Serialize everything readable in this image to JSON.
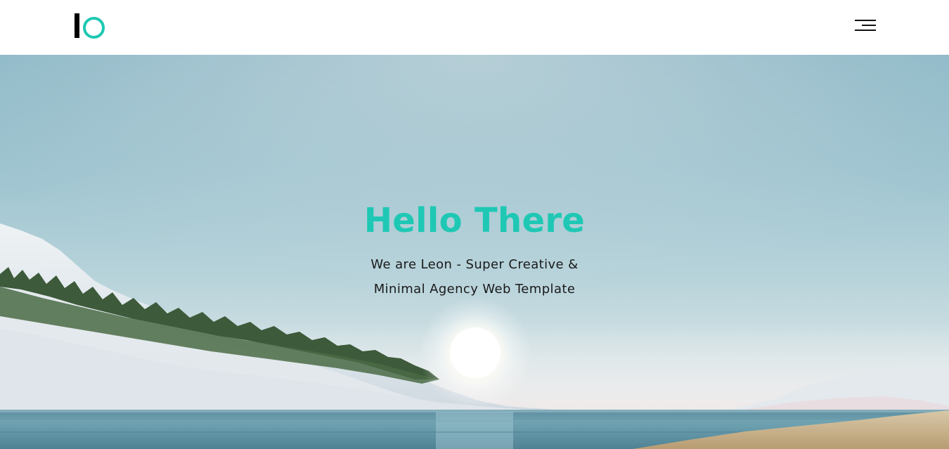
{
  "header": {
    "logo_icon": "io-logo-icon",
    "menu_icon": "hamburger-menu-icon"
  },
  "hero": {
    "title": "Hello There",
    "subtitle_line1": "We are Leon - Super Creative &",
    "subtitle_line2": "Minimal Agency Web Template",
    "background": "landscape-photo-lake-snowy-hills-forest-sun"
  },
  "colors": {
    "accent": "#1ec8b4",
    "text": "#1a1a1a",
    "header_bg": "#ffffff"
  }
}
